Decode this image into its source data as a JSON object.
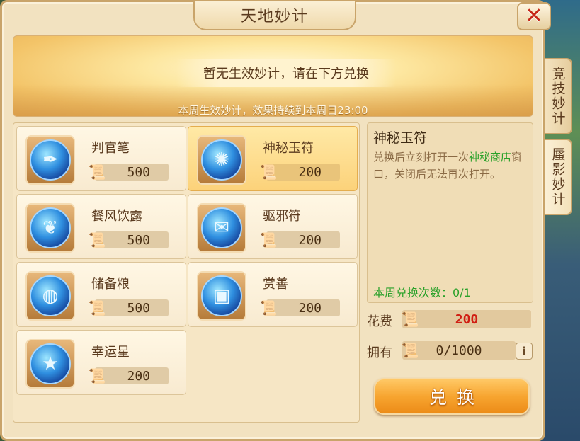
{
  "window": {
    "title": "天地妙计",
    "close_label": "✕"
  },
  "banner": {
    "message": "暂无生效妙计，请在下方兑换",
    "subtext": "本周生效妙计，效果持续到本周日23:00"
  },
  "items": [
    {
      "name": "判官笔",
      "price": "500",
      "icon": "brush-icon",
      "glyph": "✒",
      "selected": false
    },
    {
      "name": "神秘玉符",
      "price": "200",
      "icon": "jade-talisman-icon",
      "glyph": "✺",
      "selected": true
    },
    {
      "name": "餐风饮露",
      "price": "500",
      "icon": "leaf-icon",
      "glyph": "❦",
      "selected": false
    },
    {
      "name": "驱邪符",
      "price": "200",
      "icon": "talisman-icon",
      "glyph": "✉",
      "selected": false
    },
    {
      "name": "储备粮",
      "price": "500",
      "icon": "grain-bag-icon",
      "glyph": "◍",
      "selected": false
    },
    {
      "name": "赏善",
      "price": "200",
      "icon": "gift-box-icon",
      "glyph": "▣",
      "selected": false
    },
    {
      "name": "幸运星",
      "price": "200",
      "icon": "star-icon",
      "glyph": "★",
      "selected": false
    }
  ],
  "detail": {
    "title": "神秘玉符",
    "desc_before": "兑换后立刻打开一次",
    "desc_highlight": "神秘商店",
    "desc_after": "窗口，关闭后无法再次打开。",
    "weekly_count": "本周兑换次数：0/1"
  },
  "cost": {
    "label": "花费",
    "value": "200"
  },
  "own": {
    "label": "拥有",
    "value": "0/1000",
    "info_label": "i"
  },
  "exchange_button": "兑换",
  "side_tabs": [
    {
      "label": "竞技妙计",
      "active": false
    },
    {
      "label": "蜃影妙计",
      "active": true
    }
  ],
  "colors": {
    "accent_orange": "#f7a530",
    "highlight_green": "#2aa12a",
    "cost_red": "#d01e12",
    "panel_bg": "#f2e2c0"
  }
}
